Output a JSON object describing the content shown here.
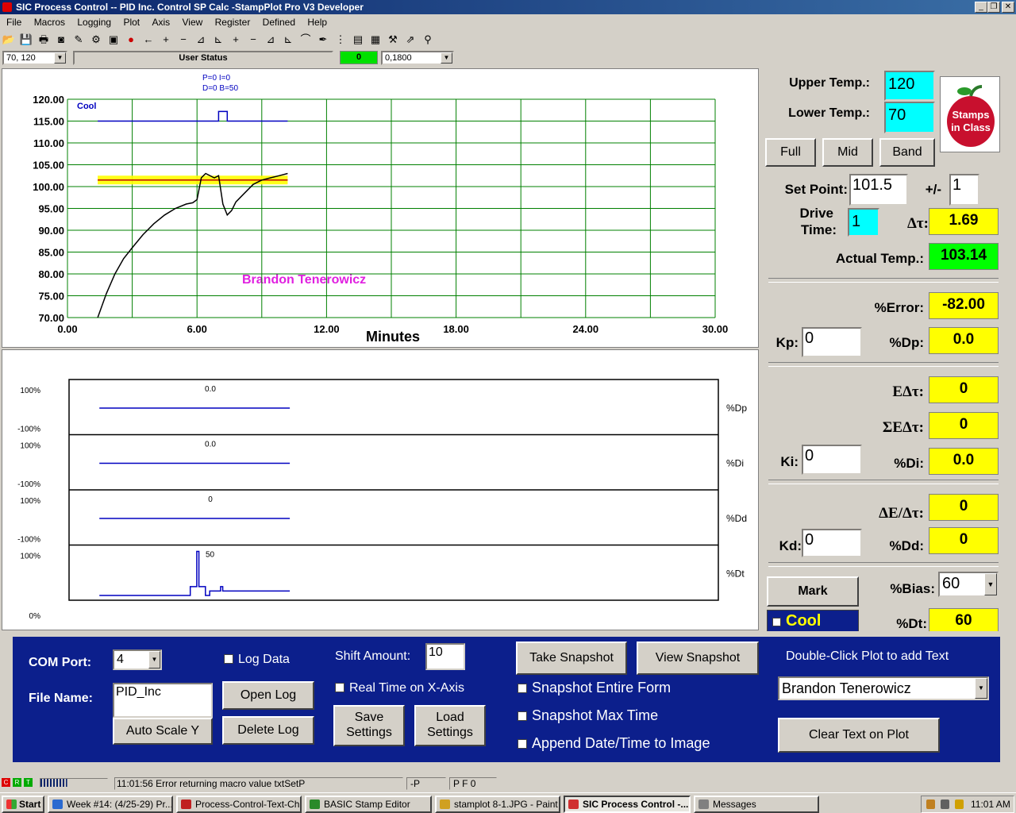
{
  "app": {
    "title": "SIC Process Control -- PID Inc. Control SP Calc -StampPlot Pro V3 Developer"
  },
  "menu": [
    "File",
    "Macros",
    "Logging",
    "Plot",
    "Axis",
    "View",
    "Register",
    "Defined",
    "Help"
  ],
  "toolbar": {
    "xy_value": "70, 120",
    "user_status": "User Status",
    "count": "0",
    "time_value": "0,1800"
  },
  "main_plot": {
    "pid_label_1": "P=0 I=0",
    "pid_label_2": "D=0 B=50",
    "cool_label": "Cool",
    "annotation": "Brandon Tenerowicz",
    "xlabel": "Minutes"
  },
  "chart_data": [
    {
      "type": "line",
      "xlabel": "Minutes",
      "x_ticks": [
        "0.00",
        "6.00",
        "12.00",
        "18.00",
        "24.00",
        "30.00"
      ],
      "y_ticks": [
        "120.00",
        "115.00",
        "110.00",
        "105.00",
        "100.00",
        "95.00",
        "90.00",
        "85.00",
        "80.00",
        "75.00",
        "70.00"
      ],
      "xlim": [
        0,
        30
      ],
      "ylim": [
        70,
        120
      ],
      "grid": true,
      "setpoint_band": {
        "low": 100.5,
        "high": 102.5,
        "center": 101.5
      },
      "series": [
        {
          "name": "Cool",
          "color": "#0000c0",
          "x": [
            1.4,
            7.0,
            7.0,
            7.4,
            7.4,
            10.2
          ],
          "y": [
            115,
            115,
            117.2,
            117.2,
            115,
            115
          ]
        },
        {
          "color": "#000000",
          "x": [
            1.4,
            1.8,
            2.2,
            2.6,
            3.0,
            3.5,
            4.0,
            4.5,
            5.0,
            5.5,
            5.8,
            6.0,
            6.2,
            6.4,
            6.8,
            7.0,
            7.2,
            7.4,
            7.6,
            7.8,
            8.2,
            8.6,
            9.0,
            9.4,
            9.8,
            10.2
          ],
          "y": [
            70,
            75.5,
            80,
            83.5,
            86,
            89,
            91.5,
            93.5,
            95,
            96,
            96.3,
            97,
            102,
            103,
            102,
            102.5,
            96,
            93.5,
            94.5,
            96.5,
            98.5,
            100.5,
            101.5,
            102,
            102.5,
            103
          ]
        }
      ]
    },
    {
      "type": "line",
      "subplots": [
        {
          "name": "%Dp",
          "label": "%Dp",
          "value_label": "0.0",
          "ymax": "100%",
          "ymin": "-100%",
          "x": [
            1.4,
            10.2
          ],
          "y": [
            0,
            0
          ]
        },
        {
          "name": "%Di",
          "label": "%Di",
          "value_label": "0.0",
          "ymax": "100%",
          "ymin": "-100%",
          "x": [
            1.4,
            10.2
          ],
          "y": [
            0,
            0
          ]
        },
        {
          "name": "%Dd",
          "label": "%Dd",
          "value_label": "0",
          "ymax": "100%",
          "ymin": "-100%",
          "x": [
            1.4,
            10.2
          ],
          "y": [
            0,
            0
          ]
        },
        {
          "name": "%Dt",
          "label": "%Dt",
          "value_label": "50",
          "ymax": "100%",
          "ymin": "0%",
          "x": [
            1.4,
            5.6,
            5.6,
            5.9,
            5.9,
            6.0,
            6.0,
            6.3,
            6.3,
            6.5,
            6.5,
            7.0,
            7.0,
            7.1,
            7.1,
            10.2
          ],
          "y": [
            0,
            0,
            20,
            20,
            100,
            100,
            20,
            20,
            0,
            0,
            10,
            10,
            20,
            20,
            10,
            10
          ]
        }
      ]
    }
  ],
  "right": {
    "upper_temp_label": "Upper Temp.:",
    "upper_temp": "120",
    "lower_temp_label": "Lower Temp.:",
    "lower_temp": "70",
    "full": "Full",
    "mid": "Mid",
    "band": "Band",
    "logo_l1": "Stamps",
    "logo_l2": "in Class",
    "set_point_label": "Set Point:",
    "set_point": "101.5",
    "pm_label": "+/-",
    "pm_value": "1",
    "drive_label_1": "Drive",
    "drive_label_2": "Time:",
    "drive_time": "1",
    "dt_label": "Δτ:",
    "dt_value": "1.69",
    "actual_label": "Actual Temp.:",
    "actual_value": "103.14",
    "error_label": "%Error:",
    "error_value": "-82.00",
    "kp_label": "Kp:",
    "kp_value": "0",
    "dp_label": "%Dp:",
    "dp_value": "0.0",
    "edt_label": "EΔτ:",
    "edt_value": "0",
    "sedt_label": "ΣEΔτ:",
    "sedt_value": "0",
    "ki_label": "Ki:",
    "ki_value": "0",
    "di_label": "%Di:",
    "di_value": "0.0",
    "dedt_label": "ΔE/Δτ:",
    "dedt_value": "0",
    "kd_label": "Kd:",
    "kd_value": "0",
    "dd_label": "%Dd:",
    "dd_value": "0",
    "mark": "Mark",
    "bias_label": "%Bias:",
    "bias_value": "60",
    "cool": "Cool",
    "pdt_label": "%Dt:",
    "pdt_value": "60"
  },
  "bottom": {
    "com_label": "COM Port:",
    "com_value": "4",
    "log_data": "Log Data",
    "shift_label": "Shift Amount:",
    "shift_value": "10",
    "file_label": "File Name:",
    "file_value": "PID_Inc",
    "open_log": "Open Log",
    "delete_log": "Delete Log",
    "auto_scale": "Auto Scale Y",
    "real_time": "Real Time on X-Axis",
    "save_1": "Save",
    "save_2": "Settings",
    "load_1": "Load",
    "load_2": "Settings",
    "take_snapshot": "Take Snapshot",
    "view_snapshot": "View Snapshot",
    "snap_entire": "Snapshot Entire Form",
    "snap_max": "Snapshot Max Time",
    "append_date": "Append Date/Time to Image",
    "double_click": "Double-Click Plot to add Text",
    "text_value": "Brandon Tenerowicz",
    "clear_text": "Clear Text on Plot"
  },
  "status": {
    "message": "11:01:56 Error returning macro value txtSetP",
    "p": "-P",
    "pf": "P F 0"
  },
  "taskbar": {
    "start": "Start",
    "tasks": [
      "Week #14: (4/25-29) Pr...",
      "Process-Control-Text-Ch...",
      "BASIC Stamp Editor",
      "stamplot 8-1.JPG - Paint",
      "SIC Process Control -...",
      "Messages"
    ],
    "clock": "11:01 AM"
  }
}
